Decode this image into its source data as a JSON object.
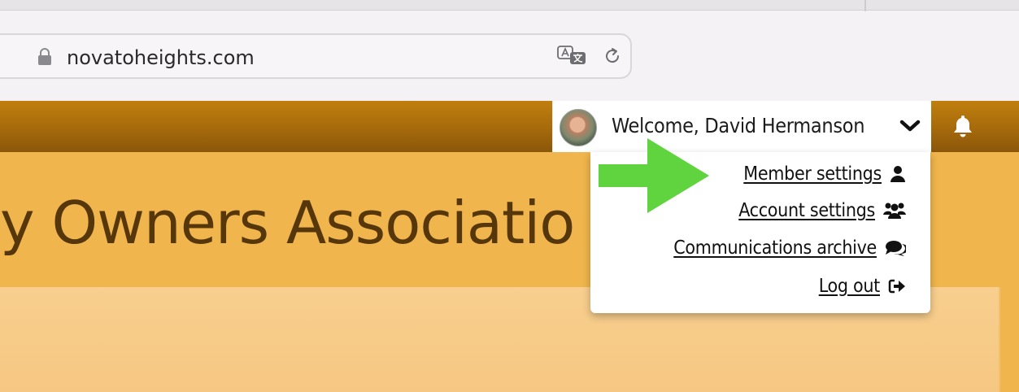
{
  "browser": {
    "url": "novatoheights.com"
  },
  "header": {
    "welcome_text": "Welcome, David Hermanson",
    "avatar_icon": "user-avatar",
    "bell_icon": "bell-icon"
  },
  "page": {
    "title_fragment": "y Owners Associatio"
  },
  "menu": {
    "items": [
      {
        "label": "Member settings",
        "icon": "user-icon"
      },
      {
        "label": "Account settings",
        "icon": "users-icon"
      },
      {
        "label": "Communications archive",
        "icon": "comments-icon"
      },
      {
        "label": "Log out",
        "icon": "sign-out-icon"
      }
    ]
  },
  "colors": {
    "header_brown": "#a66a0b",
    "banner_orange": "#f0b54c",
    "arrow_green": "#5fd43e",
    "title_brown": "#56360b"
  }
}
